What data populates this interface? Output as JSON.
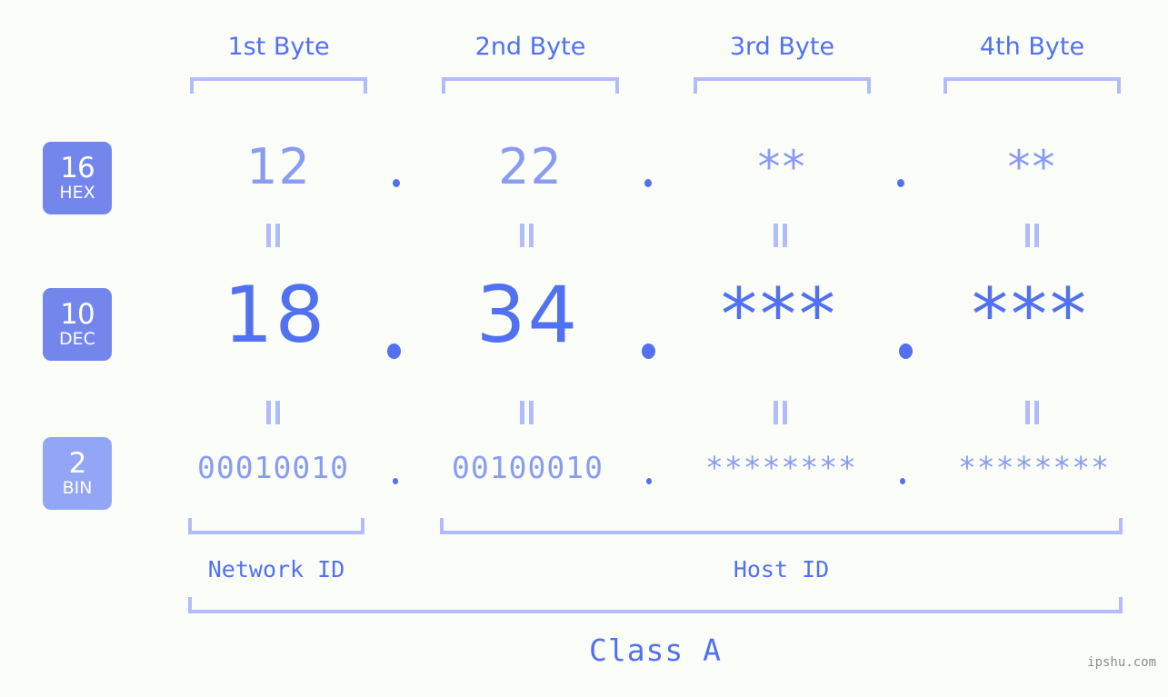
{
  "page": {
    "background_color": "#fbfdf8",
    "accent_color": "#5271f0",
    "accent_light_color": "#8a9cf2",
    "bracket_color": "#b3bcfb",
    "watermark": "ipshu.com"
  },
  "byte_headers": [
    {
      "label": "1st Byte"
    },
    {
      "label": "2nd Byte"
    },
    {
      "label": "3rd Byte"
    },
    {
      "label": "4th Byte"
    }
  ],
  "rows": [
    {
      "key": "hex",
      "badge": {
        "num": "16",
        "name": "HEX",
        "color": "#7386ec"
      },
      "values": [
        "12",
        "22",
        "**",
        "**"
      ],
      "separator": "."
    },
    {
      "key": "dec",
      "badge": {
        "num": "10",
        "name": "DEC",
        "color": "#7386ec"
      },
      "values": [
        "18",
        "34",
        "***",
        "***"
      ],
      "separator": "."
    },
    {
      "key": "bin",
      "badge": {
        "num": "2",
        "name": "BIN",
        "color": "#93a6f5"
      },
      "values": [
        "00010010",
        "00100010",
        "********",
        "********"
      ],
      "separator": "."
    }
  ],
  "equality_marks": {
    "symbol": "=",
    "count_per_gap": 4,
    "gaps": 2
  },
  "segments": {
    "network_id": "Network ID",
    "host_id": "Host ID",
    "class": "Class A"
  }
}
